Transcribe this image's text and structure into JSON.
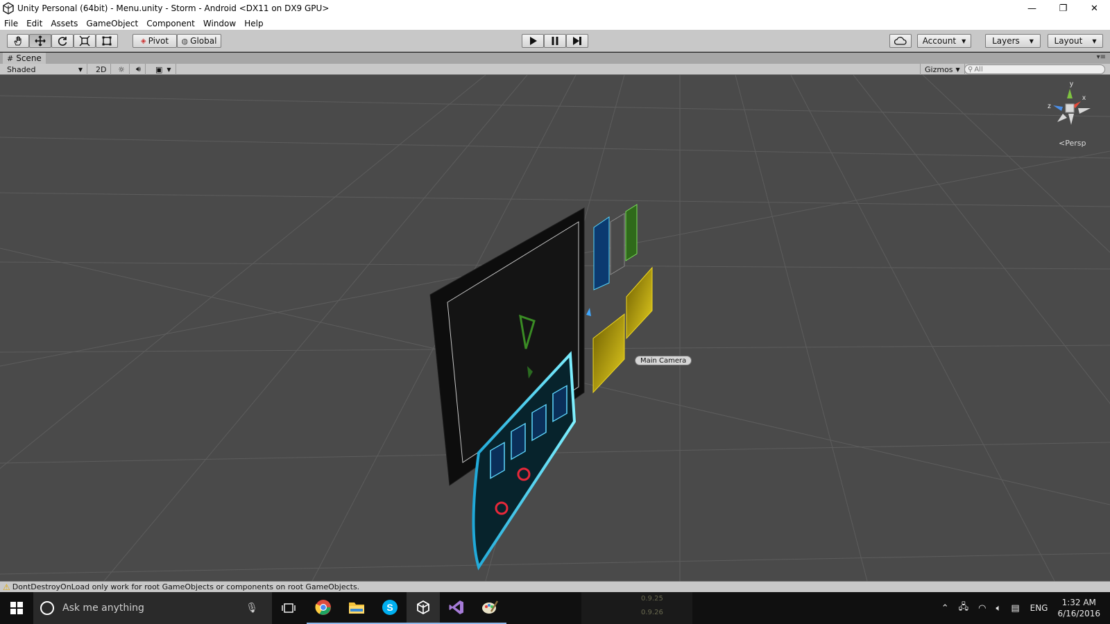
{
  "window": {
    "title": "Unity Personal (64bit) - Menu.unity - Storm - Android <DX11 on DX9 GPU>",
    "app_icon": "unity-logo-icon",
    "controls": [
      {
        "name": "minimize-icon",
        "glyph": "—"
      },
      {
        "name": "restore-icon",
        "glyph": "❐"
      },
      {
        "name": "close-icon",
        "glyph": "✕"
      }
    ]
  },
  "menu": {
    "items": [
      "File",
      "Edit",
      "Assets",
      "GameObject",
      "Component",
      "Window",
      "Help"
    ]
  },
  "toolbar": {
    "transform_tools": [
      "hand-tool-icon",
      "move-tool-icon",
      "rotate-tool-icon",
      "scale-tool-icon",
      "rect-tool-icon"
    ],
    "active_tool": "move-tool-icon",
    "pivot_label": "Pivot",
    "global_label": "Global",
    "play_controls": [
      "play-icon",
      "pause-icon",
      "step-icon"
    ],
    "cloud_icon": "cloud-icon",
    "account_label": "Account",
    "layers_label": "Layers",
    "layout_label": "Layout"
  },
  "scene": {
    "tab_label": "Scene",
    "shading_mode": "Shaded",
    "mode_2d": "2D",
    "lighting_icon": "sun-icon",
    "audio_icon": "speaker-icon",
    "effects_icon": "image-icon",
    "gizmos_label": "Gizmos",
    "search_placeholder": "All",
    "camera_label": "Main Camera",
    "projection_label": "Persp",
    "gizmo_axes": {
      "y": "y",
      "x": "x",
      "z": "z"
    }
  },
  "status": {
    "message": "DontDestroyOnLoad only work for root GameObjects or components on root GameObjects.",
    "level": "warning"
  },
  "taskbar": {
    "search_placeholder": "Ask me anything",
    "apps": [
      "chrome-icon",
      "file-explorer-icon",
      "skype-icon",
      "unity-icon",
      "visual-studio-icon",
      "paint-icon"
    ],
    "background_values": [
      "0.9.25",
      "0.9.26"
    ],
    "language": "ENG",
    "time": "1:32 AM",
    "date": "6/16/2016"
  },
  "colors": {
    "viewport_bg": "#4a4a4a",
    "panel_gray": "#c8c8c8",
    "taskbar_bg": "#101010",
    "gizmo_y": "#7ec241",
    "gizmo_x": "#e84a3a",
    "gizmo_z": "#4a8ee8",
    "ui_cyan": "#36d8ff",
    "ui_green": "#4cbb3a",
    "ui_gold": "#c8b010"
  }
}
